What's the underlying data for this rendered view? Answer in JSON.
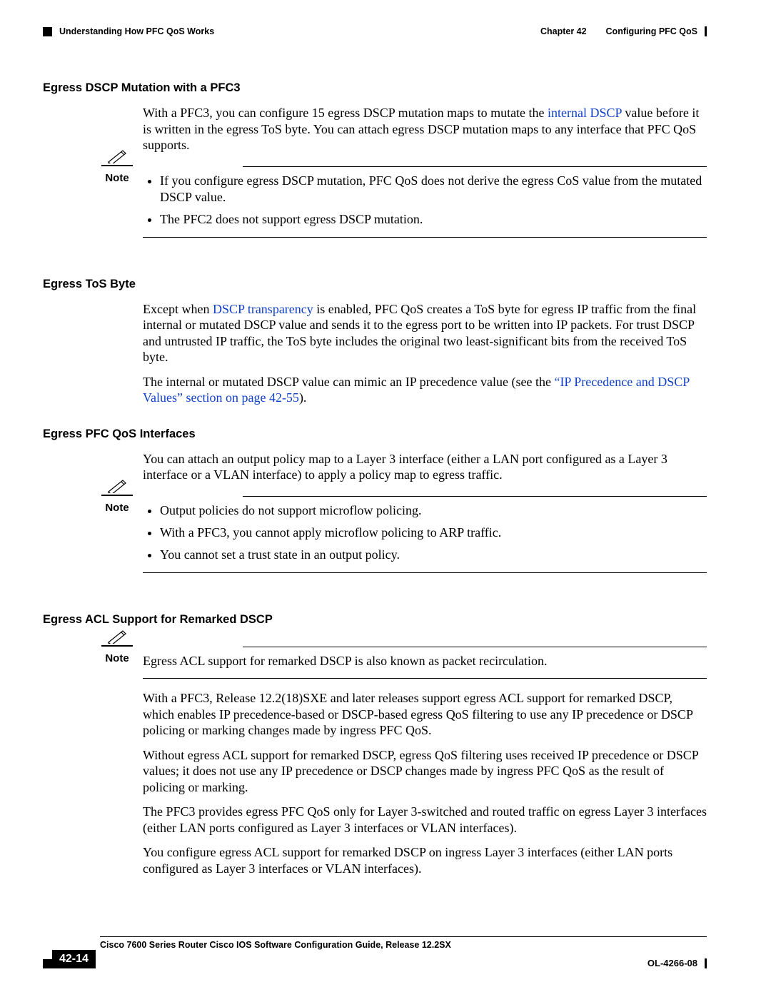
{
  "header": {
    "section": "Understanding How PFC QoS Works",
    "chapter_prefix": "Chapter 42",
    "chapter_title": "Configuring PFC QoS"
  },
  "sec1": {
    "heading": "Egress DSCP Mutation with a PFC3",
    "p1_a": "With a PFC3, you can configure 15 egress DSCP mutation maps to mutate the ",
    "p1_link": "internal DSCP",
    "p1_b": " value before it is written in the egress ToS byte. You can attach egress DSCP mutation maps to any interface that PFC QoS supports.",
    "note_label": "Note",
    "note_b1": "If you configure egress DSCP mutation, PFC QoS does not derive the egress CoS value from the mutated DSCP value.",
    "note_b2": "The PFC2 does not support egress DSCP mutation."
  },
  "sec2": {
    "heading": "Egress ToS Byte",
    "p1_a": "Except when ",
    "p1_link": "DSCP transparency",
    "p1_b": " is enabled, PFC QoS creates a ToS byte for egress IP traffic from the final internal or mutated DSCP value and sends it to the egress port to be written into IP packets. For trust DSCP and untrusted IP traffic, the ToS byte includes the original two least-significant bits from the received ToS byte.",
    "p2_a": "The internal or mutated DSCP value can mimic an IP precedence value (see the ",
    "p2_link": "“IP Precedence and DSCP Values” section on page 42-55",
    "p2_b": ")."
  },
  "sec3": {
    "heading": "Egress PFC QoS Interfaces",
    "p1": "You can attach an output policy map to a Layer 3 interface (either a LAN port configured as a Layer 3 interface or a VLAN interface) to apply a policy map to egress traffic.",
    "note_label": "Note",
    "note_b1": "Output policies do not support microflow policing.",
    "note_b2": "With a PFC3, you cannot apply microflow policing to ARP traffic.",
    "note_b3": "You cannot set a trust state in an output policy."
  },
  "sec4": {
    "heading": "Egress ACL Support for Remarked DSCP",
    "note_label": "Note",
    "note_text": "Egress ACL support for remarked DSCP is also known as packet recirculation.",
    "p1": "With a PFC3, Release 12.2(18)SXE and later releases support egress ACL support for remarked DSCP, which enables IP precedence-based or DSCP-based egress QoS filtering to use any IP precedence or DSCP policing or marking changes made by ingress PFC QoS.",
    "p2": "Without egress ACL support for remarked DSCP, egress QoS filtering uses received IP precedence or DSCP values; it does not use any IP precedence or DSCP changes made by ingress PFC QoS as the result of policing or marking.",
    "p3": "The PFC3 provides egress PFC QoS only for Layer 3-switched and routed traffic on egress Layer 3 interfaces (either LAN ports configured as Layer 3 interfaces or VLAN interfaces).",
    "p4": "You configure egress ACL support for remarked DSCP on ingress Layer 3 interfaces (either LAN ports configured as Layer 3 interfaces or VLAN interfaces)."
  },
  "footer": {
    "book": "Cisco 7600 Series Router Cisco IOS Software Configuration Guide, Release 12.2SX",
    "page": "42-14",
    "docnum": "OL-4266-08"
  }
}
